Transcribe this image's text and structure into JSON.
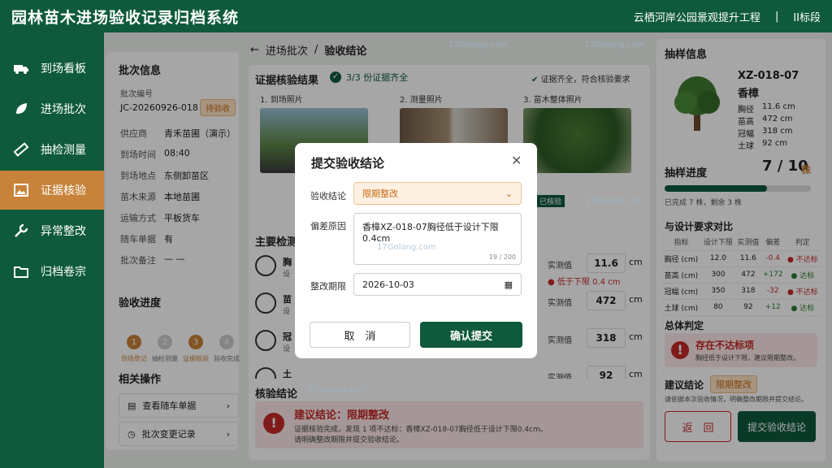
{
  "app": {
    "title": "园林苗木进场验收记录归档系统",
    "project": "云栖河岸公园景观提升工程",
    "separator": "|",
    "section": "II标段"
  },
  "nav": [
    {
      "label": "到场看板",
      "icon": "truck-icon"
    },
    {
      "label": "进场批次",
      "icon": "leaf-icon"
    },
    {
      "label": "抽检测量",
      "icon": "ruler-icon"
    },
    {
      "label": "证据核验",
      "icon": "image-icon",
      "active": true
    },
    {
      "label": "异常整改",
      "icon": "wrench-icon"
    },
    {
      "label": "归档卷宗",
      "icon": "folder-icon"
    }
  ],
  "batch": {
    "heading": "批次信息",
    "id_label": "批次编号",
    "id": "JC-20260926-018",
    "status": "待验收",
    "fields": [
      {
        "k": "供应商",
        "v": "青禾苗圃（演示）"
      },
      {
        "k": "到场时间",
        "v": "08:40"
      },
      {
        "k": "到场地点",
        "v": "东侧卸苗区"
      },
      {
        "k": "苗木来源",
        "v": "本地苗圃"
      },
      {
        "k": "运输方式",
        "v": "平板货车"
      },
      {
        "k": "随车单据",
        "v": "有"
      },
      {
        "k": "批次备注",
        "v": "— —"
      }
    ]
  },
  "progress": {
    "heading": "验收进度",
    "steps": [
      {
        "n": "1",
        "label": "到场登记",
        "done": true
      },
      {
        "n": "2",
        "label": "抽检测量",
        "done": false
      },
      {
        "n": "3",
        "label": "证据核验",
        "done": true
      },
      {
        "n": "4",
        "label": "验收完成",
        "done": false
      }
    ]
  },
  "ops": {
    "heading": "相关操作",
    "items": [
      "查看随车单据",
      "批次变更记录"
    ]
  },
  "breadcrumb": {
    "parent": "进场批次",
    "sep": "/",
    "current": "验收结论"
  },
  "evidence": {
    "heading": "证据核验结果",
    "count": "3/3 份证据齐全",
    "note": "证据齐全，符合核验要求",
    "photos": [
      {
        "label": "1. 到场照片",
        "tag": "已核"
      },
      {
        "label": "2. 测量照片",
        "tag": ""
      },
      {
        "label": "3. 苗木整体照片",
        "tag": "已核验"
      }
    ]
  },
  "measure": {
    "heading": "主要检测",
    "unit": "cm",
    "rows": [
      {
        "name": "胸",
        "sub": "设",
        "label": "实测值",
        "value": "11.6",
        "warn": "低于下限 0.4 cm"
      },
      {
        "name": "苗",
        "sub": "设",
        "label": "实测值",
        "value": "472",
        "warn": ""
      },
      {
        "name": "冠",
        "sub": "设",
        "label": "实测值",
        "value": "318",
        "warn": ""
      },
      {
        "name": "土",
        "sub": "设",
        "label": "实测值",
        "value": "92",
        "warn": ""
      }
    ]
  },
  "conclusion": {
    "heading": "核验结论",
    "title": "建议结论：限期整改",
    "line1": "证据核验完成，发现 1 项不达标：香樟XZ-018-07胸径低于设计下限0.4cm。",
    "line2": "请明确整改期限并提交验收结论。"
  },
  "sample": {
    "heading": "抽样信息",
    "id": "XZ-018-07",
    "name": "香樟",
    "specs": [
      {
        "k": "胸径",
        "v": "11.6 cm"
      },
      {
        "k": "苗高",
        "v": "472 cm"
      },
      {
        "k": "冠幅",
        "v": "318 cm"
      },
      {
        "k": "土球",
        "v": "92 cm"
      }
    ],
    "progress_label": "抽样进度",
    "progress_value": "7 / 10",
    "progress_unit": "株",
    "progress_fraction": 0.7,
    "progress_note": "已完成 7 株，剩余 3 株"
  },
  "compare": {
    "heading": "与设计要求对比",
    "cols": [
      "指标",
      "设计下限",
      "实测值",
      "偏差",
      "判定"
    ],
    "rows": [
      [
        "胸径 (cm)",
        "12.0",
        "11.6",
        "-0.4",
        "不达标"
      ],
      [
        "苗高 (cm)",
        "300",
        "472",
        "+172",
        "达标"
      ],
      [
        "冠幅 (cm)",
        "350",
        "318",
        "-32",
        "不达标"
      ],
      [
        "土球 (cm)",
        "80",
        "92",
        "+12",
        "达标"
      ]
    ]
  },
  "overall": {
    "heading": "总体判定",
    "title": "存在不达标项",
    "desc": "胸径低于设计下限，建议限期整改。"
  },
  "suggest": {
    "label": "建议结论",
    "value": "限期整改",
    "hint": "请依据本次验收情况，明确整改期限并提交结论。",
    "back": "返　回",
    "submit": "提交验收结论"
  },
  "modal": {
    "title": "提交验收结论",
    "conclusion_label": "验收结论",
    "conclusion_value": "限期整改",
    "reason_label": "偏差原因",
    "reason_value": "香樟XZ-018-07胸径低于设计下限0.4cm",
    "reason_count": "19 / 200",
    "deadline_label": "整改期限",
    "deadline_value": "2026-10-03",
    "cancel": "取　消",
    "confirm": "确认提交"
  },
  "watermark": "17Golang.com",
  "colors": {
    "primary": "#0f5a3c",
    "accent": "#c8833a",
    "danger": "#c62828"
  }
}
